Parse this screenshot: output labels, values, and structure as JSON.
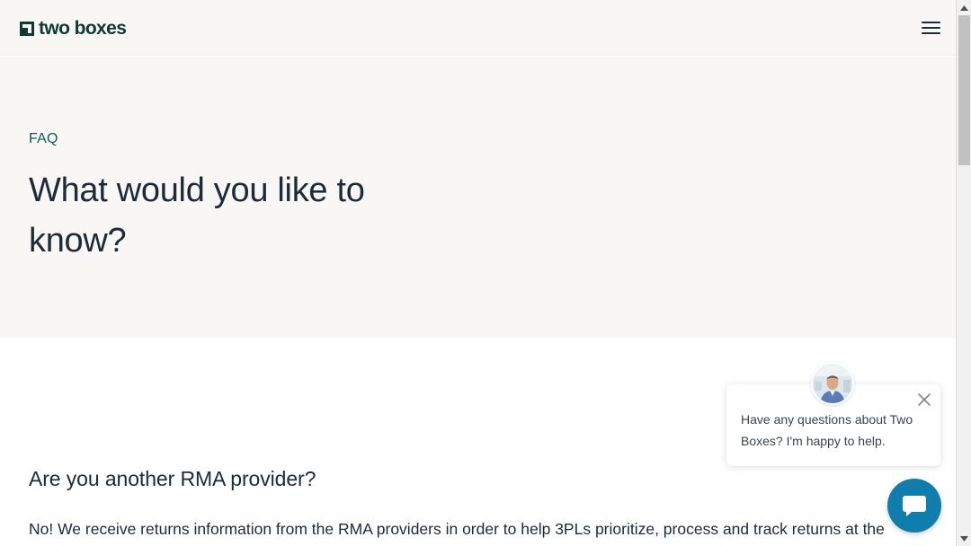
{
  "header": {
    "logo_text": "two boxes",
    "logo_icon": "box-mark-icon",
    "menu_icon": "hamburger-menu-icon",
    "brand_color": "#0f3a32"
  },
  "hero": {
    "eyebrow": "FAQ",
    "title": "What would you like to know?",
    "background": "#f8f7f5",
    "accent_color": "#0e5b4f"
  },
  "faq": {
    "items": [
      {
        "question": "Are you another RMA provider?",
        "answer": "No! We receive returns information from the RMA providers in order to help 3PLs prioritize, process and track returns at the"
      }
    ]
  },
  "chat": {
    "message": "Have any questions about Two Boxes? I'm happy to help.",
    "close_icon": "close-icon",
    "avatar_icon": "agent-avatar-icon",
    "launcher_icon": "chat-bubble-icon",
    "launcher_color": "#0f7eac"
  },
  "scrollbar": {
    "up_icon": "scroll-up-arrow-icon",
    "down_icon": "scroll-down-arrow-icon"
  }
}
